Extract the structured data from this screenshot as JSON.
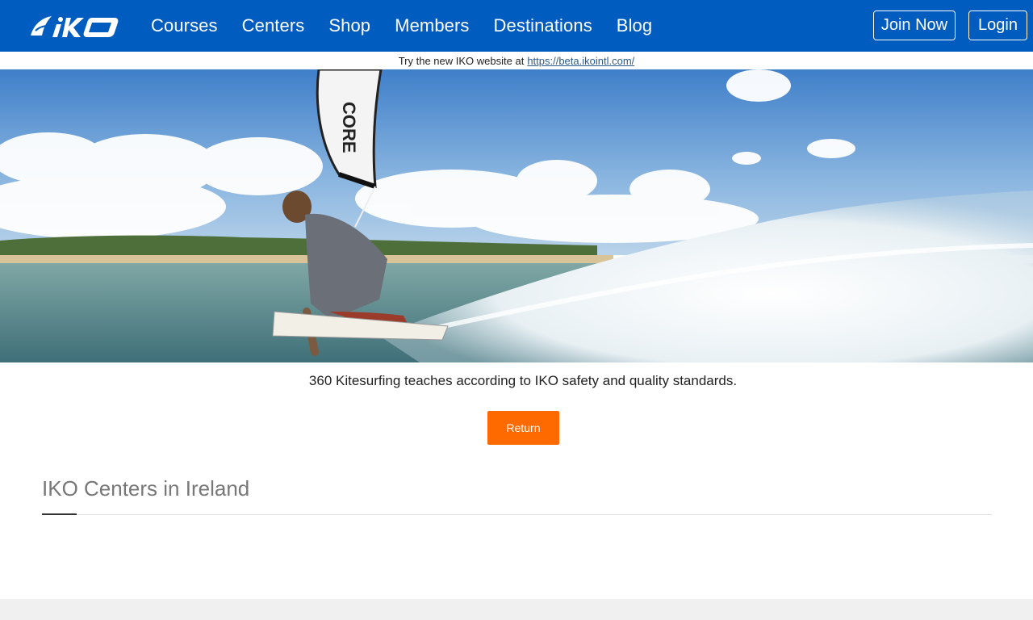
{
  "nav": {
    "logo_alt": "IKO",
    "links": [
      "Courses",
      "Centers",
      "Shop",
      "Members",
      "Destinations",
      "Blog"
    ],
    "join_label": "Join Now",
    "login_label": "Login"
  },
  "banner": {
    "text": "Try the new IKO website at",
    "link_text": "https://beta.ikointl.com/"
  },
  "hero": {
    "kite_text": "CORE"
  },
  "tagline": "360 Kitesurfing teaches according to IKO safety and quality standards.",
  "return_label": "Return",
  "section": {
    "title": "IKO Centers in Ireland"
  },
  "colors": {
    "nav_bg": "#005cbf",
    "accent_button": "#ff6a00"
  }
}
